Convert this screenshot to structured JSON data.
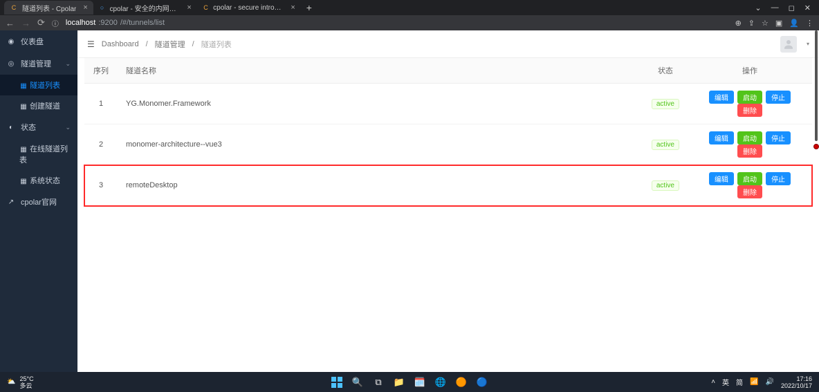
{
  "browser": {
    "tabs": [
      {
        "title": "隧道列表 - Cpolar",
        "favicon": "C",
        "fav_color": "#e8a23c",
        "active": true
      },
      {
        "title": "cpolar - 安全的内网穿透工具",
        "favicon": "○",
        "fav_color": "#4aa8ff",
        "active": false
      },
      {
        "title": "cpolar - secure introspectable",
        "favicon": "C",
        "fav_color": "#e8a23c",
        "active": false
      }
    ],
    "url_host": "localhost",
    "url_port": ":9200",
    "url_path": "/#/tunnels/list"
  },
  "sidebar": {
    "items": [
      {
        "icon": "dashboard",
        "label": "仪表盘"
      },
      {
        "icon": "manage",
        "label": "隧道管理",
        "expandable": true
      },
      {
        "sub": true,
        "label": "隧道列表",
        "active": true
      },
      {
        "sub": true,
        "label": "创建隧道"
      },
      {
        "icon": "status",
        "label": "状态",
        "expandable": true
      },
      {
        "sub": true,
        "label": "在线隧道列表"
      },
      {
        "sub": true,
        "label": "系统状态"
      },
      {
        "icon": "link",
        "label": "cpolar官网"
      }
    ]
  },
  "breadcrumb": {
    "a": "Dashboard",
    "b": "隧道管理",
    "c": "隧道列表"
  },
  "table": {
    "headers": {
      "seq": "序列",
      "name": "隧道名称",
      "status": "状态",
      "ops": "操作"
    },
    "status_label": "active",
    "btns": {
      "edit": "编辑",
      "start": "启动",
      "stop": "停止",
      "del": "删除"
    },
    "rows": [
      {
        "seq": "1",
        "name": "YG.Monomer.Framework"
      },
      {
        "seq": "2",
        "name": "monomer-architecture--vue3"
      },
      {
        "seq": "3",
        "name": "remoteDesktop",
        "highlight": true
      }
    ]
  },
  "taskbar": {
    "temp": "25°C",
    "cond": "多云",
    "ime": "英",
    "ime2": "简",
    "time": "17:16",
    "date": "2022/10/17"
  }
}
